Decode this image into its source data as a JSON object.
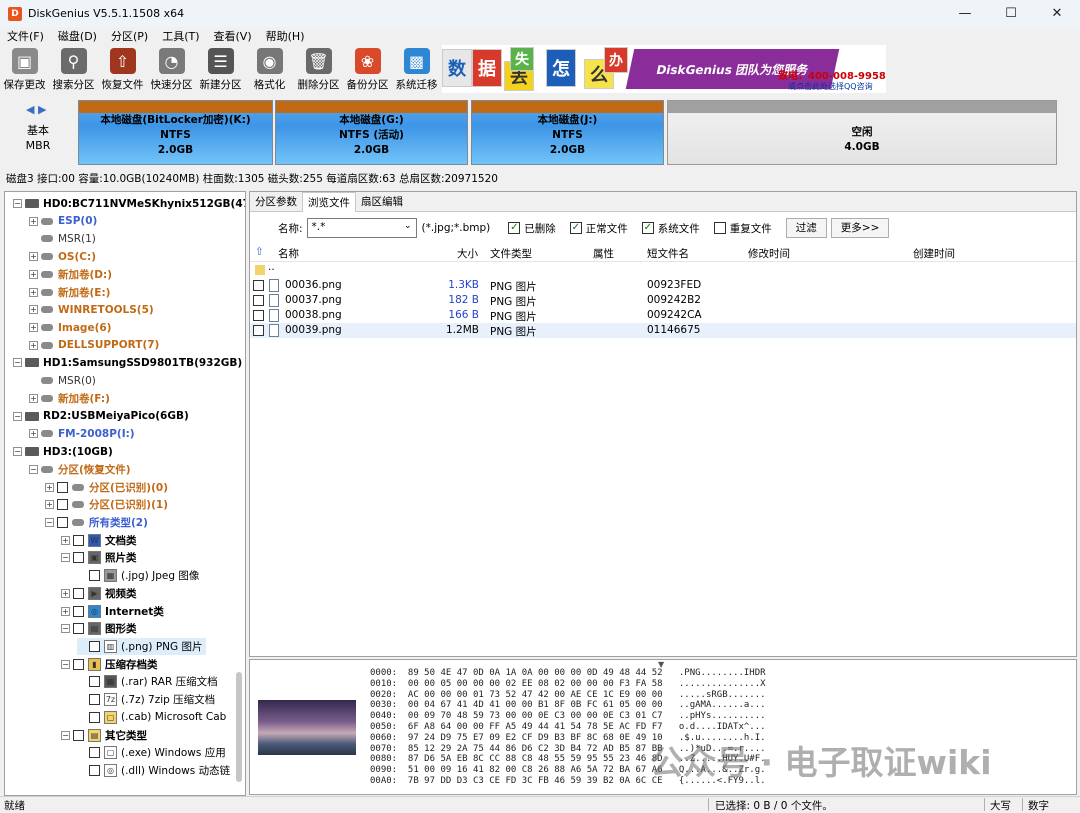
{
  "window": {
    "title": "DiskGenius V5.5.1.1508 x64",
    "icon_text": "D"
  },
  "menu": [
    "文件(F)",
    "磁盘(D)",
    "分区(P)",
    "工具(T)",
    "查看(V)",
    "帮助(H)"
  ],
  "toolbar": [
    {
      "label": "保存更改",
      "icon": "save-icon",
      "color": "#8a8a8a"
    },
    {
      "label": "搜索分区",
      "icon": "search-partition-icon",
      "color": "#6b6b6b"
    },
    {
      "label": "恢复文件",
      "icon": "recover-files-icon",
      "color": "#a0361e"
    },
    {
      "label": "快速分区",
      "icon": "quick-partition-icon",
      "color": "#7a7a7a"
    },
    {
      "label": "新建分区",
      "icon": "new-partition-icon",
      "color": "#555555"
    },
    {
      "label": "格式化",
      "icon": "format-icon",
      "color": "#777777"
    },
    {
      "label": "删除分区",
      "icon": "delete-partition-icon",
      "color": "#6a6a6a"
    },
    {
      "label": "备份分区",
      "icon": "backup-partition-icon",
      "color": "#d84a2a"
    },
    {
      "label": "系统迁移",
      "icon": "system-migration-icon",
      "color": "#2f86d3"
    }
  ],
  "banner": {
    "chars": [
      "数",
      "据",
      "丢",
      "失",
      "怎",
      "么",
      "办"
    ],
    "slogan": "DiskGenius 团队为您服务",
    "tel": "致电：400-008-9958",
    "qq": "或点击此处选择QQ咨询"
  },
  "disk": {
    "type_line1": "基本",
    "type_line2": "MBR",
    "info": "磁盘3 接口:00  容量:10.0GB(10240MB)  柱面数:1305  磁头数:255  每道扇区数:63  总扇区数:20971520"
  },
  "partitions": [
    {
      "label": "本地磁盘(BitLocker加密)(K:)",
      "fs": "NTFS",
      "size": "2.0GB"
    },
    {
      "label": "本地磁盘(G:)",
      "fs": "NTFS (活动)",
      "size": "2.0GB"
    },
    {
      "label": "本地磁盘(J:)",
      "fs": "NTFS",
      "size": "2.0GB"
    },
    {
      "label": "空闲",
      "fs": "",
      "size": "4.0GB"
    }
  ],
  "tree": [
    {
      "text": "HD0:BC711NVMeSKhynix512GB(47",
      "color": "#000",
      "bold": true
    },
    {
      "text": "ESP(0)",
      "color": "#3a5fd0",
      "bold": true
    },
    {
      "text": "MSR(1)",
      "color": "#333",
      "bold": false
    },
    {
      "text": "OS(C:)",
      "color": "#c06a16",
      "bold": true
    },
    {
      "text": "新加卷(D:)",
      "color": "#c06a16",
      "bold": true
    },
    {
      "text": "新加卷(E:)",
      "color": "#c06a16",
      "bold": true
    },
    {
      "text": "WINRETOOLS(5)",
      "color": "#c06a16",
      "bold": true
    },
    {
      "text": "Image(6)",
      "color": "#c06a16",
      "bold": true
    },
    {
      "text": "DELLSUPPORT(7)",
      "color": "#c06a16",
      "bold": true
    },
    {
      "text": "HD1:SamsungSSD9801TB(932GB)",
      "color": "#000",
      "bold": true
    },
    {
      "text": "MSR(0)",
      "color": "#333",
      "bold": false
    },
    {
      "text": "新加卷(F:)",
      "color": "#c06a16",
      "bold": true
    },
    {
      "text": "RD2:USBMeiyaPico(6GB)",
      "color": "#000",
      "bold": true
    },
    {
      "text": "FM-2008P(I:)",
      "color": "#3a5fd0",
      "bold": true
    },
    {
      "text": "HD3:(10GB)",
      "color": "#000",
      "bold": true
    },
    {
      "text": "分区(恢复文件)",
      "color": "#c06a16",
      "bold": true
    },
    {
      "text": "分区(已识别)(0)",
      "color": "#c06a16",
      "bold": true
    },
    {
      "text": "分区(已识别)(1)",
      "color": "#c06a16",
      "bold": true
    },
    {
      "text": "所有类型(2)",
      "color": "#3a5fd0",
      "bold": true
    },
    {
      "text": "文档类",
      "color": "#000",
      "bold": true
    },
    {
      "text": "照片类",
      "color": "#000",
      "bold": true
    },
    {
      "text": "(.jpg) Jpeg 图像",
      "color": "#000",
      "bold": false
    },
    {
      "text": "视频类",
      "color": "#000",
      "bold": true
    },
    {
      "text": "Internet类",
      "color": "#000",
      "bold": true
    },
    {
      "text": "图形类",
      "color": "#000",
      "bold": true
    },
    {
      "text": "(.png) PNG 图片",
      "color": "#000",
      "bold": false
    },
    {
      "text": "压缩存档类",
      "color": "#000",
      "bold": true
    },
    {
      "text": "(.rar) RAR 压缩文档",
      "color": "#000",
      "bold": false
    },
    {
      "text": "(.7z) 7zip 压缩文档",
      "color": "#000",
      "bold": false
    },
    {
      "text": "(.cab) Microsoft Cab",
      "color": "#000",
      "bold": false
    },
    {
      "text": "其它类型",
      "color": "#000",
      "bold": true
    },
    {
      "text": "(.exe) Windows 应用",
      "color": "#000",
      "bold": false
    },
    {
      "text": "(.dll) Windows 动态链",
      "color": "#000",
      "bold": false
    }
  ],
  "tabs": [
    "分区参数",
    "浏览文件",
    "扇区编辑"
  ],
  "filter": {
    "name_label": "名称:",
    "name_value": "*.*",
    "hint": "(*.jpg;*.bmp)",
    "checks": [
      {
        "label": "已删除",
        "checked": true
      },
      {
        "label": "正常文件",
        "checked": true
      },
      {
        "label": "系统文件",
        "checked": true
      },
      {
        "label": "重复文件",
        "checked": false
      }
    ],
    "filter_btn": "过滤",
    "more_btn": "更多>>"
  },
  "columns": [
    "名称",
    "大小",
    "文件类型",
    "属性",
    "短文件名",
    "修改时间",
    "创建时间"
  ],
  "parent_dir": "..",
  "files": [
    {
      "name": "00036.png",
      "size": "1.3KB",
      "type": "PNG 图片",
      "attr": "",
      "short": "00923FED",
      "blue": true
    },
    {
      "name": "00037.png",
      "size": "182 B",
      "type": "PNG 图片",
      "attr": "",
      "short": "009242B2",
      "blue": true
    },
    {
      "name": "00038.png",
      "size": "166 B",
      "type": "PNG 图片",
      "attr": "",
      "short": "009242CA",
      "blue": true
    },
    {
      "name": "00039.png",
      "size": "1.2MB",
      "type": "PNG 图片",
      "attr": "",
      "short": "01146675",
      "blue": false
    }
  ],
  "hex_lines": [
    "0000:  89 50 4E 47 0D 0A 1A 0A 00 00 00 0D 49 48 44 52   .PNG........IHDR",
    "0010:  00 00 05 00 00 00 02 EE 08 02 00 00 00 F3 FA 58   ...............X",
    "0020:  AC 00 00 00 01 73 52 47 42 00 AE CE 1C E9 00 00   .....sRGB.......",
    "0030:  00 04 67 41 4D 41 00 00 B1 8F 0B FC 61 05 00 00   ..gAMA......a...",
    "0040:  00 09 70 48 59 73 00 00 0E C3 00 00 0E C3 01 C7   ..pHYs..........",
    "0050:  6F A8 64 00 00 FF A5 49 44 41 54 78 5E AC FD F7   o.d....IDATx^...",
    "0060:  97 24 D9 75 E7 09 E2 CF D9 B3 BF 8C 68 0E 49 10   .$.u........h.I.",
    "0070:  85 12 29 2A 75 44 86 D6 C2 3D B4 72 AD B5 87 BB   ..)*uD...=.r....",
    "0080:  87 D6 5A EB 8C CC 88 C8 48 55 59 95 55 23 46 8D   ..Z.....HUY.U#F.",
    "0090:  51 00 09 16 41 82 00 C8 26 88 A6 5A 72 BA 67 A6   Q...A...&..Zr.g.",
    "00A0:  7B 97 DD D3 C3 CE FD 3C FB 46 59 39 B2 0A 6C CE   {......<.FY9..l."
  ],
  "watermark": "公众号 · 电子取证wiki",
  "status": {
    "left": "就绪",
    "selected": "已选择: 0 B / 0 个文件。",
    "caps": "大写",
    "num": "数字"
  }
}
